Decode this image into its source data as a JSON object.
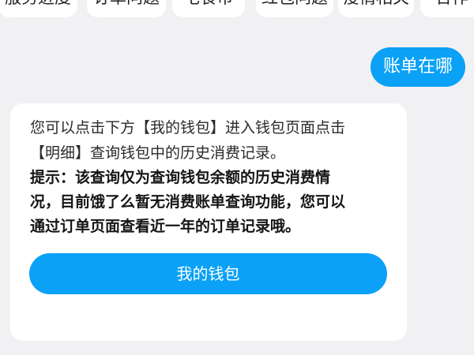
{
  "quick_topics": [
    {
      "label": "服务进度"
    },
    {
      "label": "订单问题"
    },
    {
      "label": "宅食币"
    },
    {
      "label": "红包问题"
    },
    {
      "label": "疫情相关"
    },
    {
      "label": "合作"
    }
  ],
  "conversation": {
    "user_message": "账单在哪",
    "bot_reply": {
      "line1": "您可以点击下方【我的钱包】进入钱包页面点击",
      "line2": "【明细】查询钱包中的历史消费记录。",
      "tip_line1": "提示：该查询仅为查询钱包余额的历史消费情",
      "tip_line2": "况，目前饿了么暂无消费账单查询功能，您可以",
      "tip_line3": "通过订单页面查看近一年的订单记录哦。",
      "button_label": "我的钱包"
    }
  },
  "colors": {
    "background": "#f1f1f3",
    "accent": "#0aa1f6",
    "card": "#ffffff"
  }
}
